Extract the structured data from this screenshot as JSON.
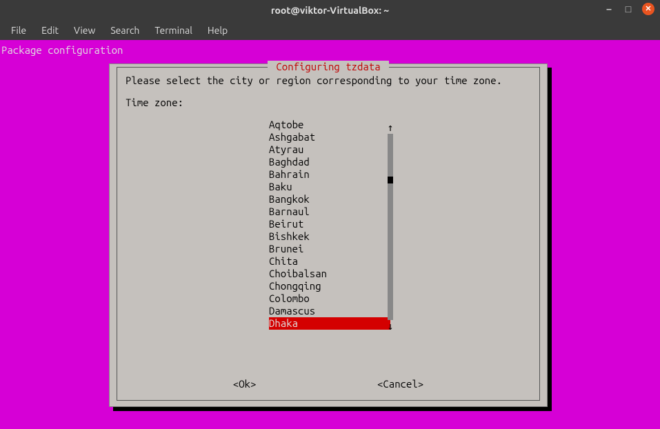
{
  "window": {
    "title": "root@viktor-VirtualBox: ~"
  },
  "menubar": {
    "file": "File",
    "edit": "Edit",
    "view": "View",
    "search": "Search",
    "terminal": "Terminal",
    "help": "Help"
  },
  "terminal": {
    "header": "Package configuration"
  },
  "dialog": {
    "title": " Configuring tzdata ",
    "prompt": "Please select the city or region corresponding to your time zone.",
    "label": "Time zone:",
    "items": [
      "Aqtobe",
      "Ashgabat",
      "Atyrau",
      "Baghdad",
      "Bahrain",
      "Baku",
      "Bangkok",
      "Barnaul",
      "Beirut",
      "Bishkek",
      "Brunei",
      "Chita",
      "Choibalsan",
      "Chongqing",
      "Colombo",
      "Damascus",
      "Dhaka"
    ],
    "selected_index": 16,
    "ok": "<Ok>",
    "cancel": "<Cancel>",
    "arrow_up": "↑",
    "arrow_down": "↓"
  }
}
